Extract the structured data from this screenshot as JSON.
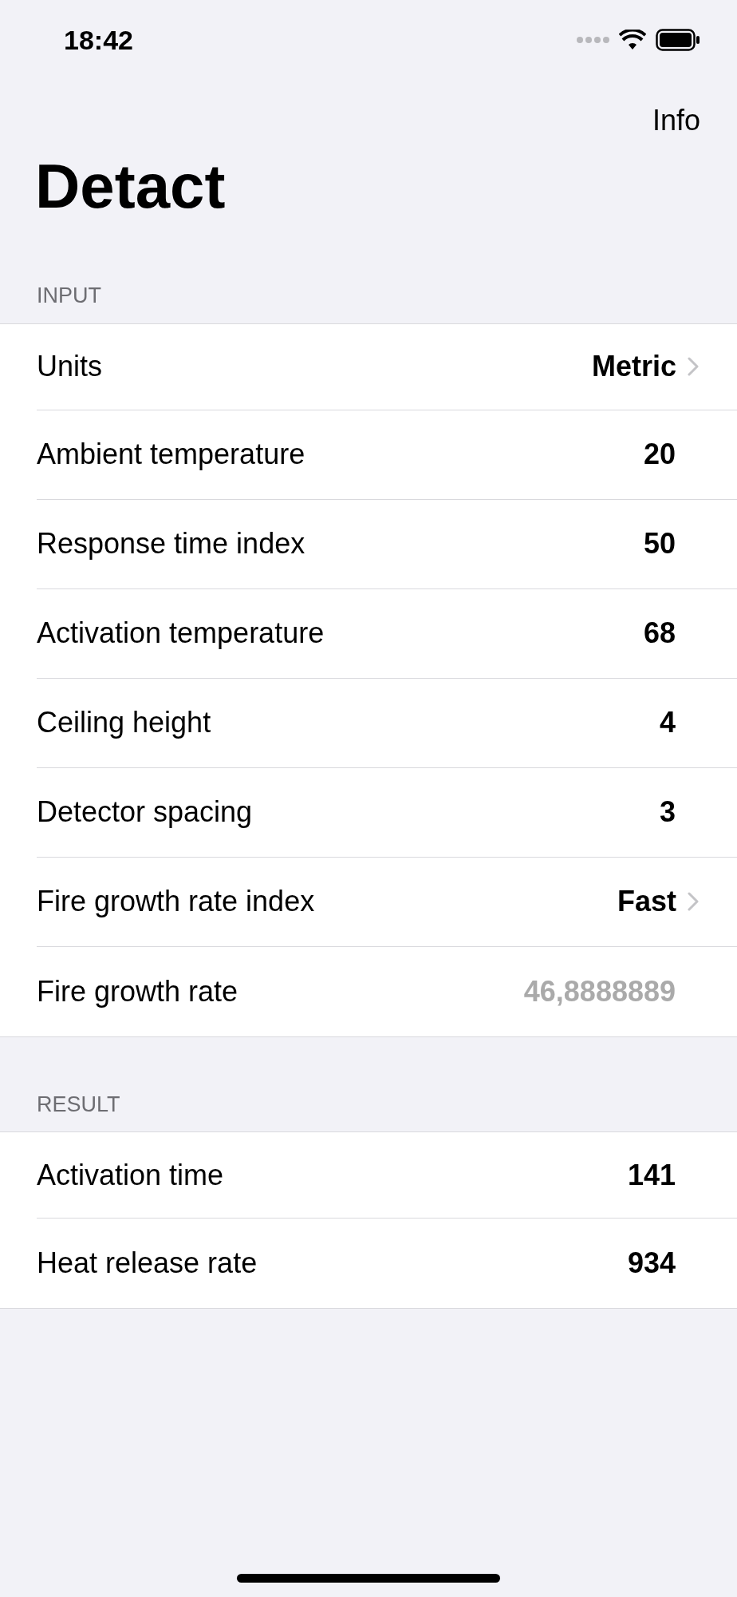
{
  "status_bar": {
    "time": "18:42"
  },
  "nav": {
    "action": "Info",
    "title": "Detact"
  },
  "sections": [
    {
      "header": "INPUT",
      "rows": [
        {
          "label": "Units",
          "value": "Metric",
          "kind": "picker"
        },
        {
          "label": "Ambient temperature",
          "value": "20",
          "kind": "input"
        },
        {
          "label": "Response time index",
          "value": "50",
          "kind": "input"
        },
        {
          "label": "Activation temperature",
          "value": "68",
          "kind": "input"
        },
        {
          "label": "Ceiling height",
          "value": "4",
          "kind": "input"
        },
        {
          "label": "Detector spacing",
          "value": "3",
          "kind": "input"
        },
        {
          "label": "Fire growth rate index",
          "value": "Fast",
          "kind": "picker"
        },
        {
          "label": "Fire growth rate",
          "value": "46,8888889",
          "kind": "computed"
        }
      ]
    },
    {
      "header": "RESULT",
      "rows": [
        {
          "label": "Activation time",
          "value": "141",
          "kind": "input"
        },
        {
          "label": "Heat release rate",
          "value": "934",
          "kind": "input"
        }
      ]
    }
  ]
}
